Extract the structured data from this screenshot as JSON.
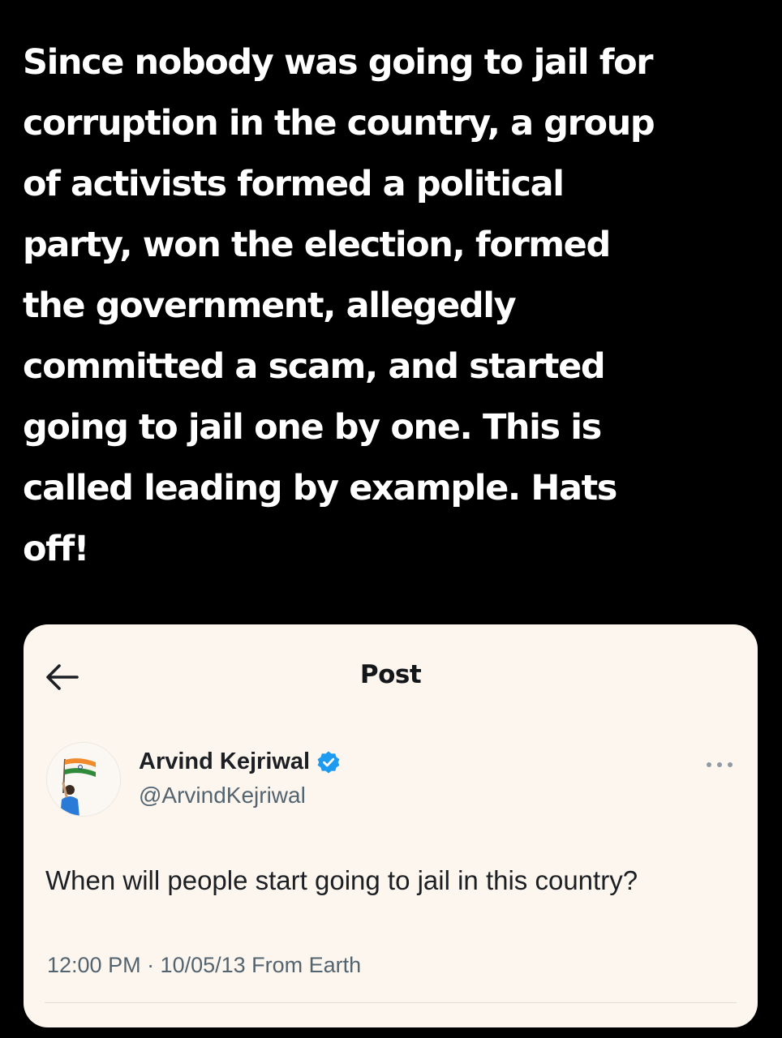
{
  "caption": {
    "lines": [
      "Since nobody was going to jail for",
      "corruption in the country, a group",
      "of activists formed a political",
      "party, won the election, formed",
      "the government, allegedly",
      "committed a scam, and started",
      "going to jail one by one. This is",
      "called leading by example. Hats",
      "off!"
    ]
  },
  "post": {
    "header": {
      "back_icon": "arrow-left-icon",
      "title": "Post"
    },
    "author": {
      "avatar_icon": "profile-photo-with-flag",
      "display_name": "Arvind Kejriwal",
      "verified_icon": "verified-badge-icon",
      "handle": "@ArvindKejriwal"
    },
    "more_icon": "more-dots-icon",
    "text": "When will people start going to jail in this country?",
    "meta": "12:00 PM · 10/05/13 From Earth"
  },
  "colors": {
    "background": "#000000",
    "caption_text": "#ffffff",
    "card_background": "#fdf6ee",
    "verified_blue": "#1d9bf0",
    "secondary_text": "#536471"
  }
}
